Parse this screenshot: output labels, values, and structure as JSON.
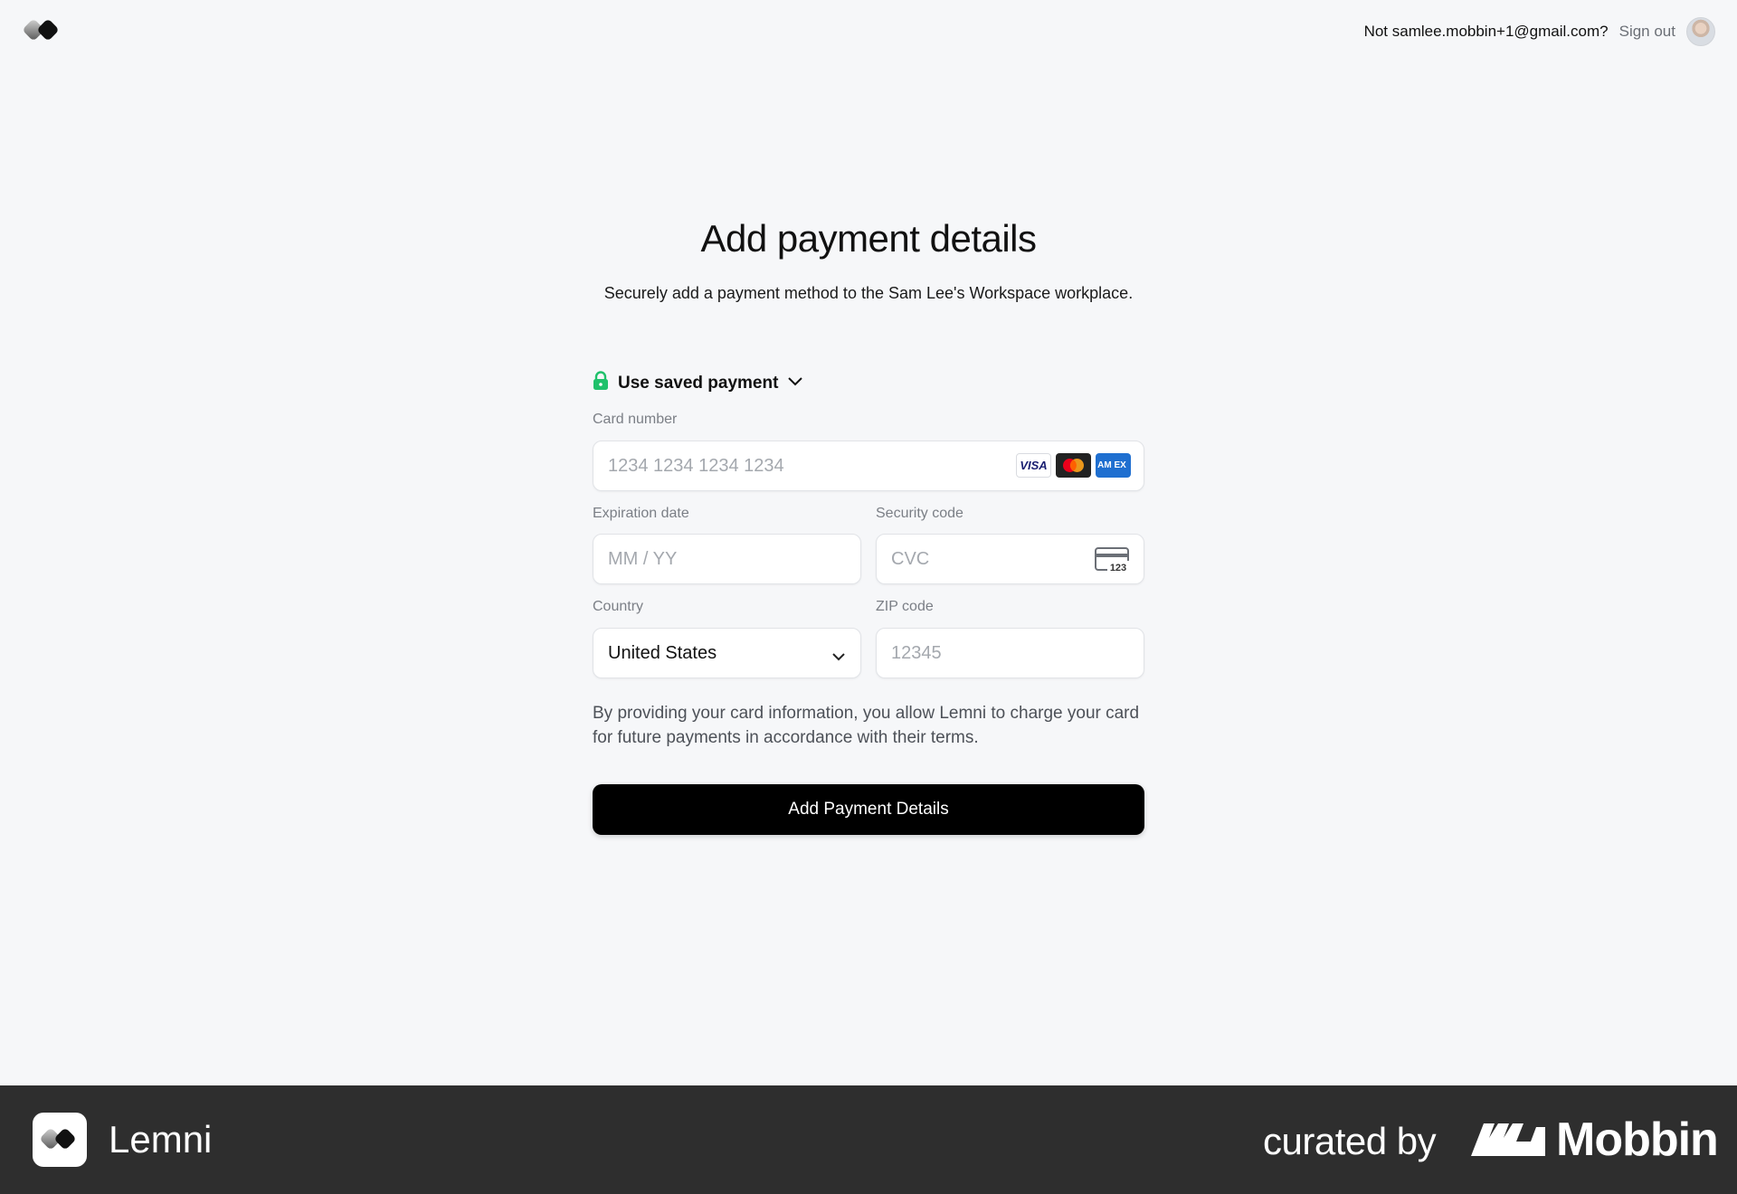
{
  "header": {
    "account_text": "Not samlee.mobbin+1@gmail.com?",
    "signout_label": "Sign out"
  },
  "main": {
    "title": "Add payment details",
    "subtitle": "Securely add a payment method to the Sam Lee's Workspace workplace.",
    "saved_payment_label": "Use saved payment",
    "card_number": {
      "label": "Card number",
      "placeholder": "1234 1234 1234 1234"
    },
    "card_brands": {
      "visa": "VISA",
      "amex": "AM EX"
    },
    "expiration": {
      "label": "Expiration date",
      "placeholder": "MM / YY"
    },
    "security": {
      "label": "Security code",
      "placeholder": "CVC",
      "icon_text": "123"
    },
    "country": {
      "label": "Country",
      "value": "United States"
    },
    "zip": {
      "label": "ZIP code",
      "placeholder": "12345"
    },
    "terms": "By providing your card information, you allow Lemni to charge your card for future payments in accordance with their terms.",
    "submit_label": "Add Payment Details"
  },
  "footer": {
    "brand": "Lemni",
    "curated_by": "curated by",
    "mobbin": "Mobbin"
  },
  "colors": {
    "background": "#f6f7f9",
    "primary_button": "#000000",
    "lock_icon": "#1fc16b",
    "footer_bg": "#2e2e2e"
  }
}
